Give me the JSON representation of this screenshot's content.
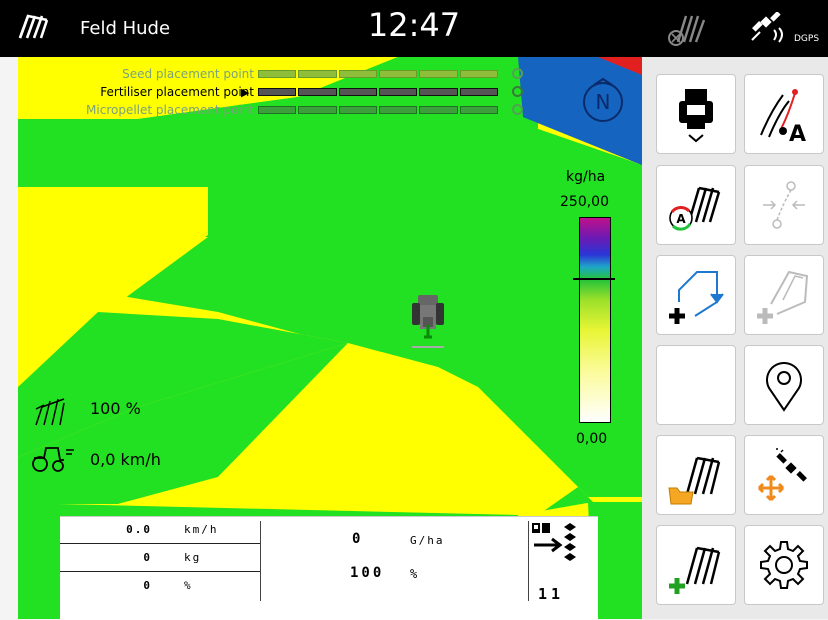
{
  "topbar": {
    "field_name": "Feld Hude",
    "time": "12:47",
    "gps_mode": "DGPS"
  },
  "sections": [
    {
      "label": "Seed placement point",
      "state": "inactive"
    },
    {
      "label": "Fertiliser placement point",
      "state": "active"
    },
    {
      "label": "Micropellet placement point",
      "state": "inactive"
    }
  ],
  "compass": {
    "label": "N"
  },
  "legend": {
    "unit": "kg/ha",
    "max": "250,00",
    "min": "0,00",
    "colors": [
      "#c0108a",
      "#2a36d6",
      "#22c23a",
      "#e8f535",
      "#ffffff"
    ]
  },
  "status": {
    "work_rate": "100 %",
    "speed": "0,0 km/h"
  },
  "panel": {
    "rows": [
      {
        "value": "0.0",
        "unit": "km/h"
      },
      {
        "value": "0",
        "unit": "kg"
      },
      {
        "value": "0",
        "unit": "%"
      }
    ],
    "rate_value": "0",
    "rate_unit": "G/ha",
    "percent_value": "100",
    "percent_unit": "%",
    "count": "11"
  },
  "side_buttons": [
    {
      "name": "tractor-menu-button",
      "icon": "tractor-down-icon"
    },
    {
      "name": "guidance-a-button",
      "icon": "guidance-a-icon"
    },
    {
      "name": "section-auto-button",
      "icon": "section-auto-icon"
    },
    {
      "name": "waypoint-disabled-button",
      "icon": "track-point-icon"
    },
    {
      "name": "add-boundary-button",
      "icon": "add-boundary-icon"
    },
    {
      "name": "add-field-disabled-button",
      "icon": "add-field-icon"
    },
    {
      "name": "empty-button",
      "icon": ""
    },
    {
      "name": "location-button",
      "icon": "location-pin-icon"
    },
    {
      "name": "open-field-button",
      "icon": "field-folder-icon"
    },
    {
      "name": "gps-move-button",
      "icon": "satellite-move-icon"
    },
    {
      "name": "new-field-button",
      "icon": "new-field-icon"
    },
    {
      "name": "settings-button",
      "icon": "gear-icon"
    }
  ],
  "colors": {
    "field_green": "#22e022",
    "field_yellow": "#ffff00",
    "headland_blue": "#1565c0",
    "accent_red": "#e32020"
  }
}
